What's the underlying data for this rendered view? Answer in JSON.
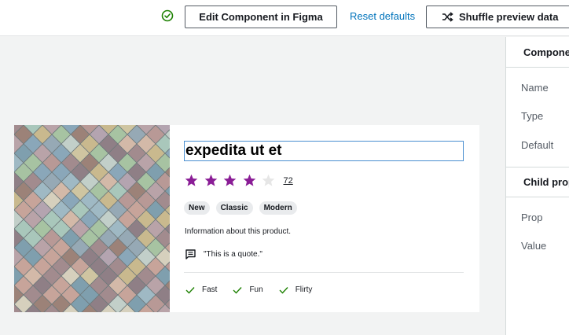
{
  "toolbar": {
    "status_icon": "check-circle-icon",
    "edit_figma_label": "Edit Component in Figma",
    "reset_label": "Reset defaults",
    "shuffle_label": "Shuffle preview data",
    "shuffle_icon": "shuffle-icon",
    "colors": {
      "status": "#1d8102",
      "link": "#0073bb"
    }
  },
  "panel": {
    "section1_title": "Componen",
    "rows1": [
      "Name",
      "Type",
      "Default"
    ],
    "section2_title": "Child prop",
    "rows2": [
      "Prop",
      "Value"
    ]
  },
  "product": {
    "title": "expedita ut et",
    "rating": 4,
    "rating_max": 5,
    "review_count": "72",
    "badges": [
      "New",
      "Classic",
      "Modern"
    ],
    "description": "Information about this product.",
    "quote_icon": "comment-icon",
    "quote": "\"This is a quote.\"",
    "features": [
      "Fast",
      "Fun",
      "Flirty"
    ],
    "feature_icon": "checkmark-icon",
    "colors": {
      "star_filled": "#8a1d96",
      "star_empty": "#e6e6e6",
      "feature_check": "#1d8102",
      "title_border": "#4a8fd0"
    }
  }
}
